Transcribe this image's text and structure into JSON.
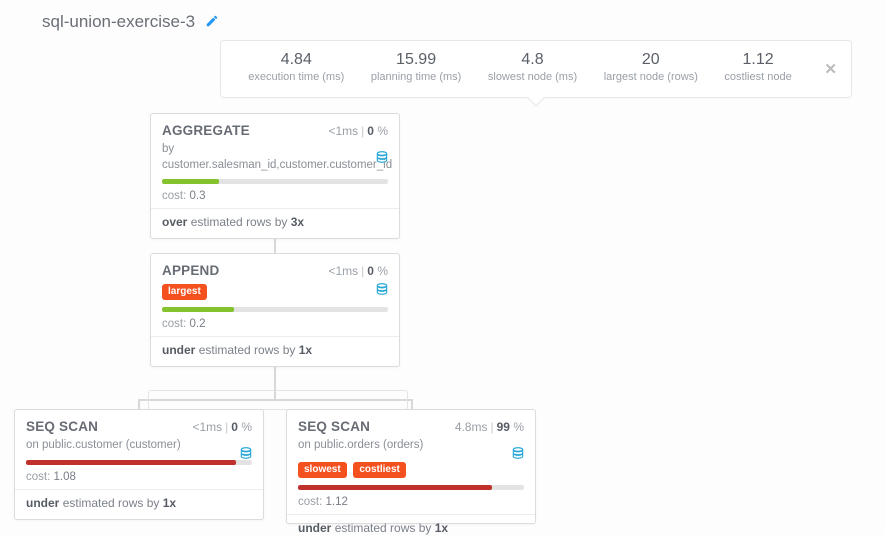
{
  "title": "sql-union-exercise-3",
  "summary": [
    {
      "value": "4.84",
      "label": "execution time (ms)"
    },
    {
      "value": "15.99",
      "label": "planning time (ms)"
    },
    {
      "value": "4.8",
      "label": "slowest node (ms)"
    },
    {
      "value": "20",
      "label": "largest node (rows)"
    },
    {
      "value": "1.12",
      "label": "costliest node"
    }
  ],
  "nodes": {
    "aggregate": {
      "op": "AGGREGATE",
      "time_prefix": "<1",
      "time_unit": "ms",
      "pct": "0",
      "detail": "by customer.salesman_id,customer.customer_id",
      "bar_pct": 25,
      "cost": "0.3",
      "est_dir": "over",
      "est_mid": "estimated rows by",
      "est_factor": "3x"
    },
    "append": {
      "op": "APPEND",
      "time_prefix": "<1",
      "time_unit": "ms",
      "pct": "0",
      "tag1": "largest",
      "bar_pct": 32,
      "cost": "0.2",
      "est_dir": "under",
      "est_mid": "estimated rows by",
      "est_factor": "1x"
    },
    "seq1": {
      "op": "SEQ SCAN",
      "time_prefix": "<1",
      "time_unit": "ms",
      "pct": "0",
      "detail": "on public.customer (customer)",
      "bar_pct": 93,
      "cost": "1.08",
      "est_dir": "under",
      "est_mid": "estimated rows by",
      "est_factor": "1x"
    },
    "seq2": {
      "op": "SEQ SCAN",
      "time_prefix": "4.8",
      "time_unit": "ms",
      "pct": "99",
      "detail": "on public.orders (orders)",
      "tag1": "slowest",
      "tag2": "costliest",
      "bar_pct": 86,
      "cost": "1.12",
      "est_dir": "under",
      "est_mid": "estimated rows by",
      "est_factor": "1x"
    }
  },
  "labels": {
    "cost": "cost:",
    "pct_suffix": " %"
  }
}
